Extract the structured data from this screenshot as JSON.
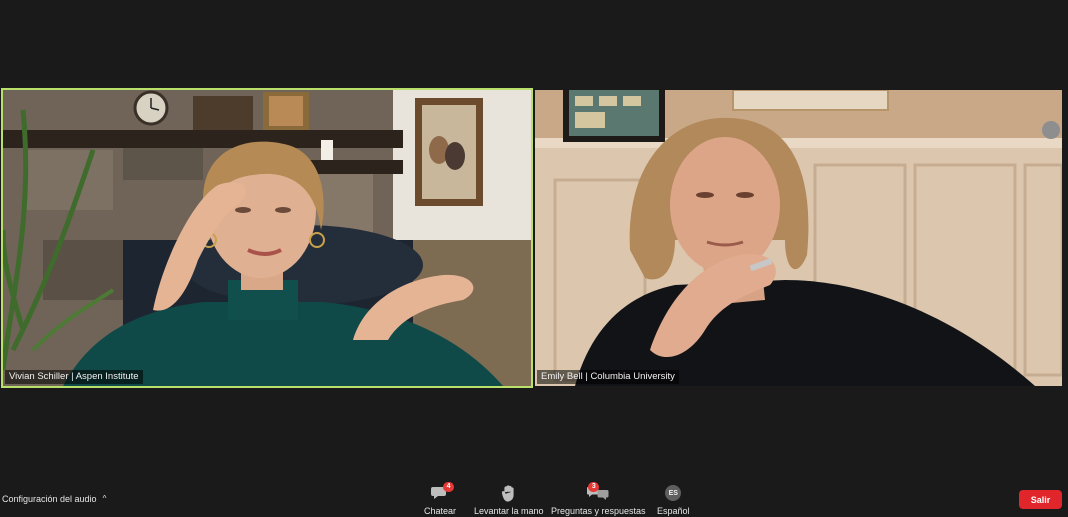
{
  "participants": [
    {
      "name_tag": "Vivian Schiller | Aspen Institute"
    },
    {
      "name_tag": "Emily Bell | Columbia University"
    }
  ],
  "toolbar": {
    "audio_config_label": "Configuración del audio",
    "audio_config_chevron": "^",
    "chat": {
      "label": "Chatear",
      "badge": "4"
    },
    "raise_hand": {
      "label": "Levantar la mano"
    },
    "qa": {
      "label": "Preguntas y respuestas",
      "badge": "3"
    },
    "language": {
      "label": "Español",
      "code": "ES"
    },
    "leave_label": "Salir"
  },
  "colors": {
    "background": "#1a1a1a",
    "active_speaker_border": "#b8e06a",
    "leave_button": "#e0262b",
    "badge": "#e53935"
  }
}
